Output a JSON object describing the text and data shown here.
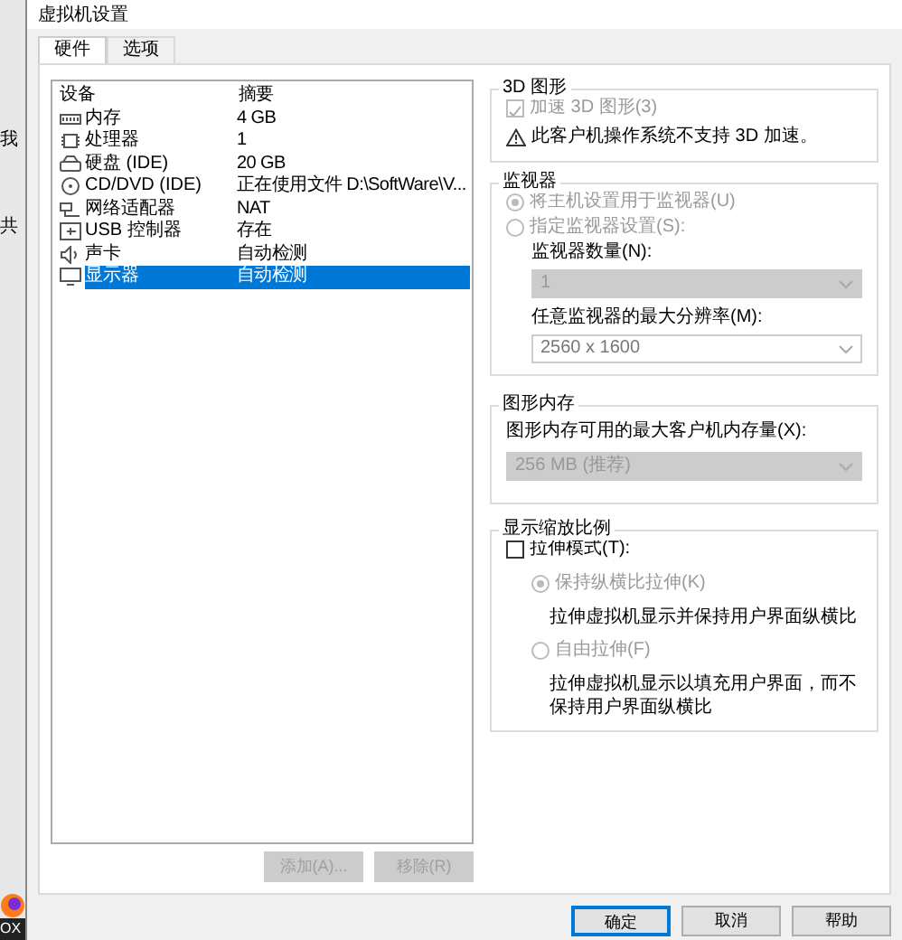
{
  "background_window": {
    "texts": [
      "我",
      "共"
    ],
    "taskbar_label": "OX"
  },
  "window": {
    "title": "虚拟机设置"
  },
  "tabs": [
    {
      "label": "硬件",
      "selected": true
    },
    {
      "label": "选项",
      "selected": false
    }
  ],
  "devices": {
    "columns": [
      "设备",
      "摘要"
    ],
    "rows": [
      {
        "kind": "memory",
        "name": "内存",
        "summary": "4 GB",
        "selected": false
      },
      {
        "kind": "cpu",
        "name": "处理器",
        "summary": "1",
        "selected": false
      },
      {
        "kind": "disk",
        "name": "硬盘 (IDE)",
        "summary": "20 GB",
        "selected": false
      },
      {
        "kind": "cdrom",
        "name": "CD/DVD (IDE)",
        "summary": "正在使用文件 D:\\SoftWare\\V...",
        "selected": false
      },
      {
        "kind": "network",
        "name": "网络适配器",
        "summary": "NAT",
        "selected": false
      },
      {
        "kind": "usb",
        "name": "USB 控制器",
        "summary": "存在",
        "selected": false
      },
      {
        "kind": "sound",
        "name": "声卡",
        "summary": "自动检测",
        "selected": false
      },
      {
        "kind": "display",
        "name": "显示器",
        "summary": "自动检测",
        "selected": true
      }
    ],
    "buttons": [
      {
        "label": "添加(A)...",
        "disabled": true
      },
      {
        "label": "移除(R)",
        "disabled": true
      }
    ]
  },
  "graphics_3d": {
    "title": "3D 图形",
    "accelerate": {
      "label": "加速 3D 图形(3)",
      "checked": true,
      "disabled": true
    },
    "warning": "此客户机操作系统不支持 3D 加速。"
  },
  "monitors": {
    "title": "监视器",
    "options": [
      {
        "label": "将主机设置用于监视器(U)",
        "selected": true,
        "disabled": true
      },
      {
        "label": "指定监视器设置(S):",
        "selected": false,
        "disabled": true
      }
    ],
    "count_label": "监视器数量(N):",
    "count_value": "1",
    "count_disabled": true,
    "resolution_label": "任意监视器的最大分辨率(M):",
    "resolution_value": "2560 x 1600",
    "resolution_disabled": false
  },
  "graphics_memory": {
    "title": "图形内存",
    "label": "图形内存可用的最大客户机内存量(X):",
    "value": "256 MB (推荐)",
    "disabled": true
  },
  "scaling": {
    "title": "显示缩放比例",
    "stretch": {
      "label": "拉伸模式(T):",
      "checked": false
    },
    "options": [
      {
        "label": "保持纵横比拉伸(K)",
        "selected": true,
        "disabled": true,
        "description": "拉伸虚拟机显示并保持用户界面纵横比"
      },
      {
        "label": "自由拉伸(F)",
        "selected": false,
        "disabled": true,
        "description": "拉伸虚拟机显示以填充用户界面，而不保持用户界面纵横比"
      }
    ]
  },
  "footer_buttons": [
    {
      "label": "确定",
      "default": true
    },
    {
      "label": "取消",
      "default": false
    },
    {
      "label": "帮助",
      "default": false
    }
  ]
}
